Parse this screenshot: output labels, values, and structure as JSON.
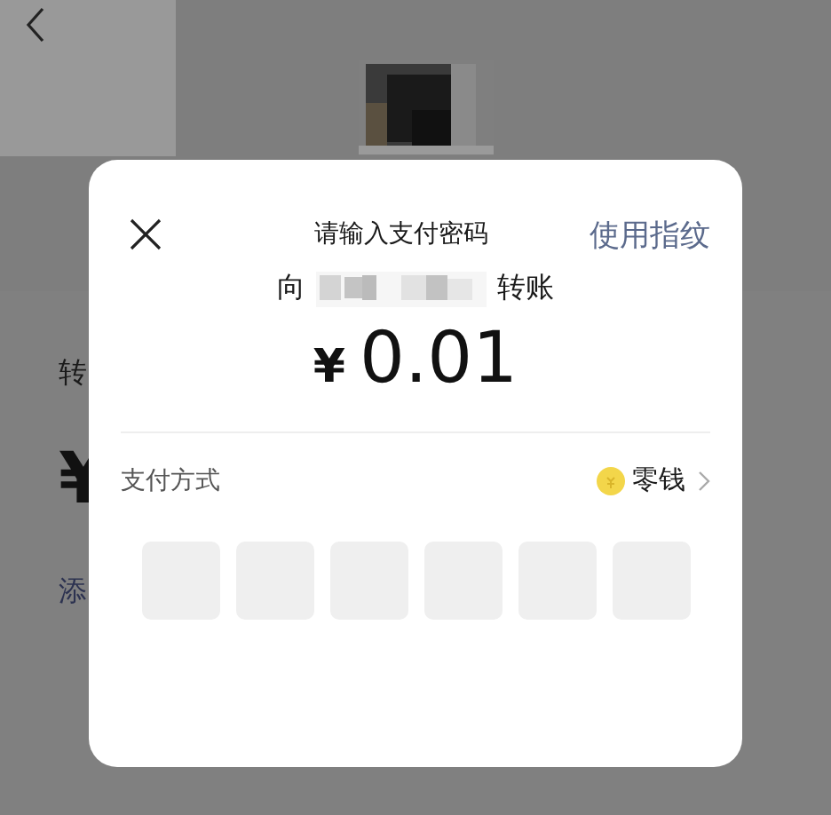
{
  "background_page": {
    "label_fragment": "转",
    "amount_fragment": "¥",
    "link_fragment": "添"
  },
  "dialog": {
    "title": "请输入支付密码",
    "alt_action": "使用指纹",
    "recipient_prefix": "向",
    "recipient_suffix": "转账",
    "currency": "¥",
    "amount": "0.01",
    "payment_method_label": "支付方式",
    "payment_method": "零钱",
    "pin_digits": [
      {
        "filled": false
      },
      {
        "filled": false
      },
      {
        "filled": false
      },
      {
        "filled": false
      },
      {
        "filled": false
      },
      {
        "filled": false
      }
    ]
  }
}
